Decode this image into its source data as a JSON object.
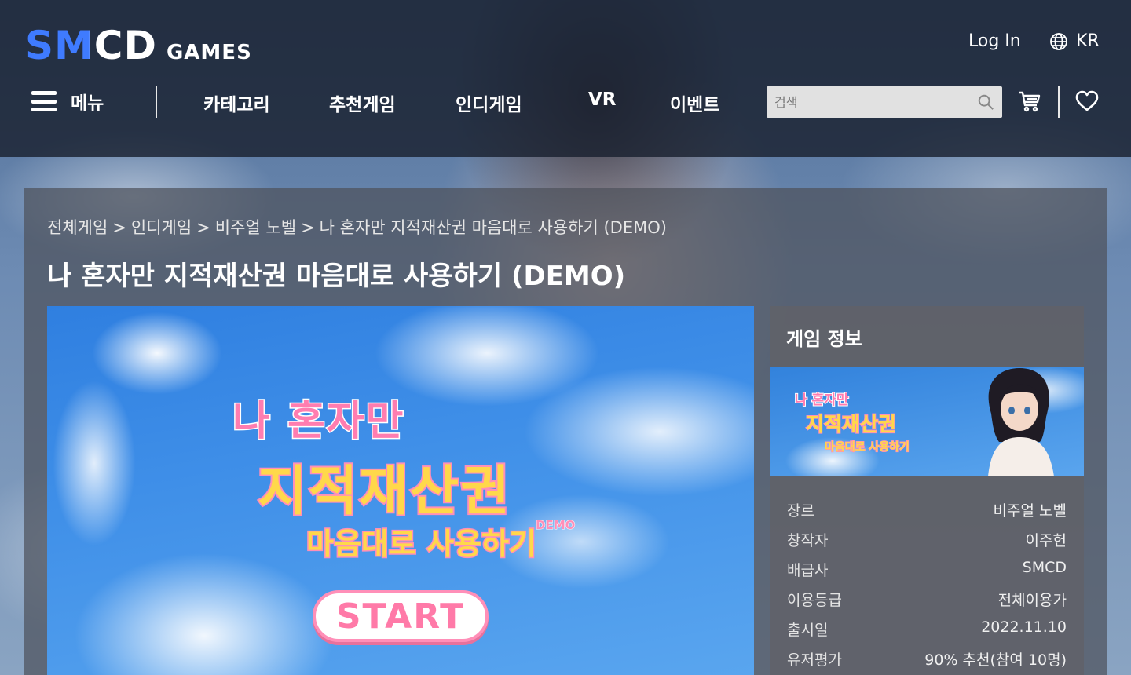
{
  "header": {
    "logo_main": "SMCD",
    "logo_sub": "GAMES",
    "login_label": "Log In",
    "language_label": "KR"
  },
  "nav": {
    "menu_label": "메뉴",
    "items": [
      {
        "label": "카테고리"
      },
      {
        "label": "추천게임"
      },
      {
        "label": "인디게임"
      },
      {
        "label": "VR"
      },
      {
        "label": "이벤트"
      }
    ],
    "search_placeholder": "검색"
  },
  "breadcrumb": {
    "items": [
      "전체게임",
      "인디게임",
      "비주얼 노벨",
      "나 혼자만 지적재산권 마음대로 사용하기 (DEMO)"
    ],
    "separator": ">"
  },
  "page_title": "나 혼자만 지적재산권 마음대로 사용하기 (DEMO)",
  "main_visual": {
    "line1": "나 혼자만",
    "line2": "지적재산권",
    "line3": "마음대로 사용하기",
    "demo_tag": "DEMO",
    "start_label": "START"
  },
  "game_info": {
    "title": "게임 정보",
    "banner": {
      "line1": "나 혼자만",
      "line2": "지적재산권",
      "line3": "마음대로 사용하기"
    },
    "rows": [
      {
        "key": "장르",
        "value": "비주얼 노벨"
      },
      {
        "key": "창작자",
        "value": "이주헌"
      },
      {
        "key": "배급사",
        "value": "SMCD"
      },
      {
        "key": "이용등급",
        "value": "전체이용가"
      },
      {
        "key": "출시일",
        "value": "2022.11.10"
      },
      {
        "key": "유저평가",
        "value": "90% 추천(참여 10명)"
      }
    ]
  },
  "colors": {
    "brand_blue": "#3f7bff",
    "header_bg": "#1a2130",
    "title_pink": "#ff7db0",
    "title_yellow": "#ffd84a"
  },
  "icons": [
    "globe-icon",
    "hamburger-icon",
    "search-icon",
    "cart-icon",
    "heart-icon"
  ]
}
